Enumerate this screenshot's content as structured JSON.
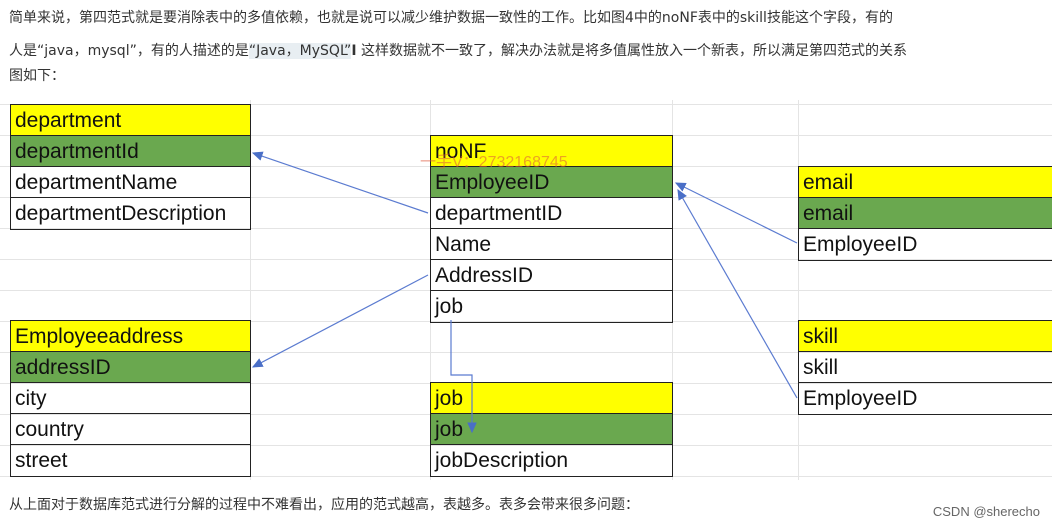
{
  "paragraph": {
    "line1": "简单来说，第四范式就是要消除表中的多值依赖，也就是说可以减少维护数据一致性的工作。比如图4中的noNF表中的skill技能这个字段，有的",
    "line2_a": "人是“java，mysql”，有的人描述的是",
    "line2_hl": "“Java，MySQL”",
    "line2_cursor": "I",
    "line2_b": "这样数据就不一致了，解决办法就是将多值属性放入一个新表，所以满足第四范式的关系",
    "line3": "图如下："
  },
  "tables": {
    "department": [
      "department",
      "departmentId",
      "departmentName",
      "departmentDescription"
    ],
    "noNF": [
      "noNF",
      "EmployeeID",
      "departmentID",
      "Name",
      "AddressID",
      "job"
    ],
    "email": [
      "email",
      "email",
      "EmployeeID"
    ],
    "employeeaddress": [
      "Employeeaddress",
      "addressID",
      "city",
      "country",
      "street"
    ],
    "skill": [
      "skill",
      "skill",
      "EmployeeID"
    ],
    "job": [
      "job",
      "job",
      "jobDescription"
    ]
  },
  "watermark": "一手V：2732168745",
  "bottom_text": "从上面对于数据库范式进行分解的过程中不难看出，应用的范式越高，表越多。表多会带来很多问题：",
  "csdn_mark": "CSDN @sherecho",
  "colors": {
    "header": "#ffff00",
    "key": "#6aa84f",
    "arrow": "#4a6fc7"
  }
}
